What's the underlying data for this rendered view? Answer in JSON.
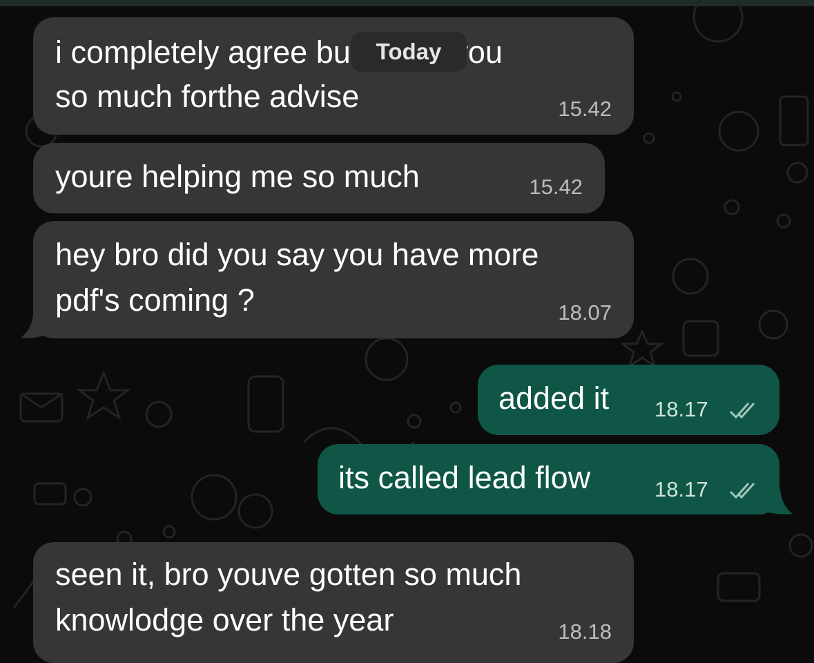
{
  "date_divider": "Today",
  "messages": [
    {
      "dir": "in",
      "lines": [
        "i completely agree but thank you",
        "so much forthe advise"
      ],
      "time": "15.42"
    },
    {
      "dir": "in",
      "lines": [
        "youre helping me so much"
      ],
      "time": "15.42"
    },
    {
      "dir": "in",
      "lines": [
        "hey bro did you say you have more",
        "pdf's coming ?"
      ],
      "time": "18.07"
    },
    {
      "dir": "out",
      "lines": [
        "added it"
      ],
      "time": "18.17",
      "status": "read"
    },
    {
      "dir": "out",
      "lines": [
        "its called lead flow"
      ],
      "time": "18.17",
      "status": "read"
    },
    {
      "dir": "in",
      "lines": [
        "seen it, bro youve gotten so much",
        "knowlodge over the year"
      ],
      "time": "18.18"
    }
  ],
  "colors": {
    "background": "#0b0b0b",
    "incoming_bubble": "#363636",
    "outgoing_bubble": "#0f5646",
    "read_ticks": "#9fc7bd"
  },
  "icons": [
    "double-check-icon"
  ]
}
